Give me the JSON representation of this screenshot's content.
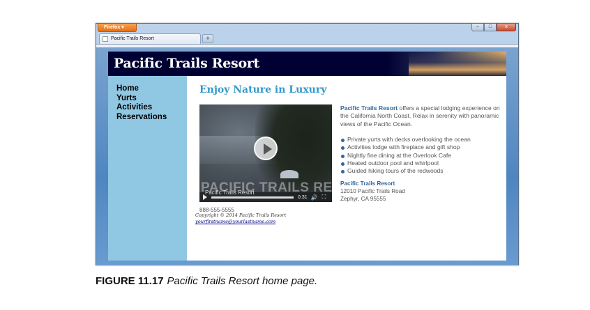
{
  "browser": {
    "app_button_label": "Firefox ▾",
    "tab_title": "Pacific Trails Resort",
    "new_tab_label": "+",
    "window_controls": {
      "minimize": "–",
      "maximize": "□",
      "close": "x"
    }
  },
  "site": {
    "title": "Pacific Trails Resort",
    "nav": [
      "Home",
      "Yurts",
      "Activities",
      "Reservations"
    ],
    "heading": "Enjoy Nature in Luxury",
    "video": {
      "overlay_text": "PACIFIC TRAILS RESORT",
      "title_overlay": "Pacific Trails Resort",
      "time": "0:31"
    },
    "phone": "888-555-5555",
    "intro_brand": "Pacific Trails Resort",
    "intro_text": " offers a special lodging experience on the California North Coast. Relax in serenity with panoramic views of the Pacific Ocean.",
    "features": [
      "Private yurts with decks overlooking the ocean",
      "Activities lodge with fireplace and gift shop",
      "Nightly fine dining at the Overlook Cafe",
      "Heated outdoor pool and whirlpool",
      "Guided hiking tours of the redwoods"
    ],
    "address": {
      "name": "Pacific Trails Resort",
      "street": "12010 Pacific Trails Road",
      "city": "Zephyr, CA 95555"
    },
    "footer": {
      "copyright": "Copyright © 2014 Pacific Trails Resort",
      "email": "yourfirstname@yourlastname.com"
    }
  },
  "caption": {
    "label": "FIGURE 11.17",
    "text": "Pacific Trails Resort home page."
  },
  "colors": {
    "header_bg": "#000033",
    "nav_bg": "#90c7e3",
    "heading": "#3399cc",
    "accent": "#336699",
    "firefox_orange": "#e66f12"
  }
}
